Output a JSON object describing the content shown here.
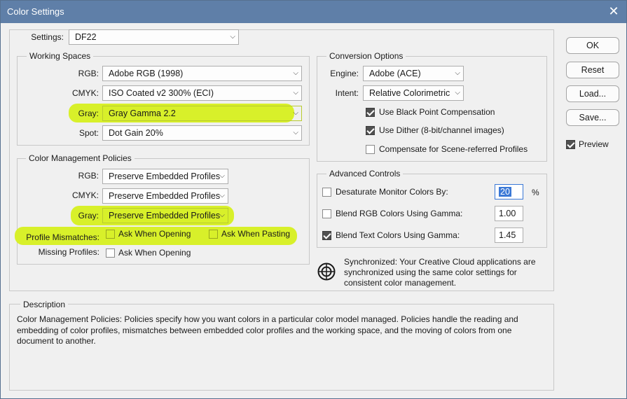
{
  "window": {
    "title": "Color Settings"
  },
  "settings": {
    "label": "Settings:",
    "value": "DF22"
  },
  "working_spaces": {
    "legend": "Working Spaces",
    "rgb": {
      "label": "RGB:",
      "value": "Adobe RGB (1998)"
    },
    "cmyk": {
      "label": "CMYK:",
      "value": "ISO Coated v2 300% (ECI)"
    },
    "gray": {
      "label": "Gray:",
      "value": "Gray Gamma 2.2"
    },
    "spot": {
      "label": "Spot:",
      "value": "Dot Gain 20%"
    }
  },
  "policies": {
    "legend": "Color Management Policies",
    "rgb": {
      "label": "RGB:",
      "value": "Preserve Embedded Profiles"
    },
    "cmyk": {
      "label": "CMYK:",
      "value": "Preserve Embedded Profiles"
    },
    "gray": {
      "label": "Gray:",
      "value": "Preserve Embedded Profiles"
    },
    "mismatch": {
      "label": "Profile Mismatches:",
      "ask_opening": "Ask When Opening",
      "ask_pasting": "Ask When Pasting",
      "opening_checked": false,
      "pasting_checked": false
    },
    "missing": {
      "label": "Missing Profiles:",
      "ask_opening": "Ask When Opening",
      "opening_checked": false
    }
  },
  "conversion": {
    "legend": "Conversion Options",
    "engine": {
      "label": "Engine:",
      "value": "Adobe (ACE)"
    },
    "intent": {
      "label": "Intent:",
      "value": "Relative Colorimetric"
    },
    "black_point": {
      "label": "Use Black Point Compensation",
      "checked": true
    },
    "dither": {
      "label": "Use Dither (8-bit/channel images)",
      "checked": true
    },
    "scene": {
      "label": "Compensate for Scene-referred Profiles",
      "checked": false
    }
  },
  "advanced": {
    "legend": "Advanced Controls",
    "desaturate": {
      "label": "Desaturate Monitor Colors By:",
      "value": "20",
      "unit": "%",
      "checked": false
    },
    "blend_rgb": {
      "label": "Blend RGB Colors Using Gamma:",
      "value": "1.00",
      "checked": false
    },
    "blend_text": {
      "label": "Blend Text Colors Using Gamma:",
      "value": "1.45",
      "checked": true
    }
  },
  "sync": {
    "text1": "Synchronized: Your Creative Cloud applications are",
    "text2": "synchronized using the same color settings for",
    "text3": "consistent color management.",
    "icon": "sync-target-icon"
  },
  "description": {
    "legend": "Description",
    "line1": "Color Management Policies:  Policies specify how you want colors in a particular color model managed.  Policies handle the reading and",
    "line2": "embedding of color profiles, mismatches between embedded color profiles and the working space, and the moving of colors from one",
    "line3": "document to another."
  },
  "buttons": {
    "ok": "OK",
    "reset": "Reset",
    "load": "Load...",
    "save": "Save...",
    "preview": "Preview",
    "preview_checked": true
  },
  "colors": {
    "titlebar": "#5f7fa8",
    "highlight": "#d8f02a",
    "selection": "#3a78d6"
  }
}
